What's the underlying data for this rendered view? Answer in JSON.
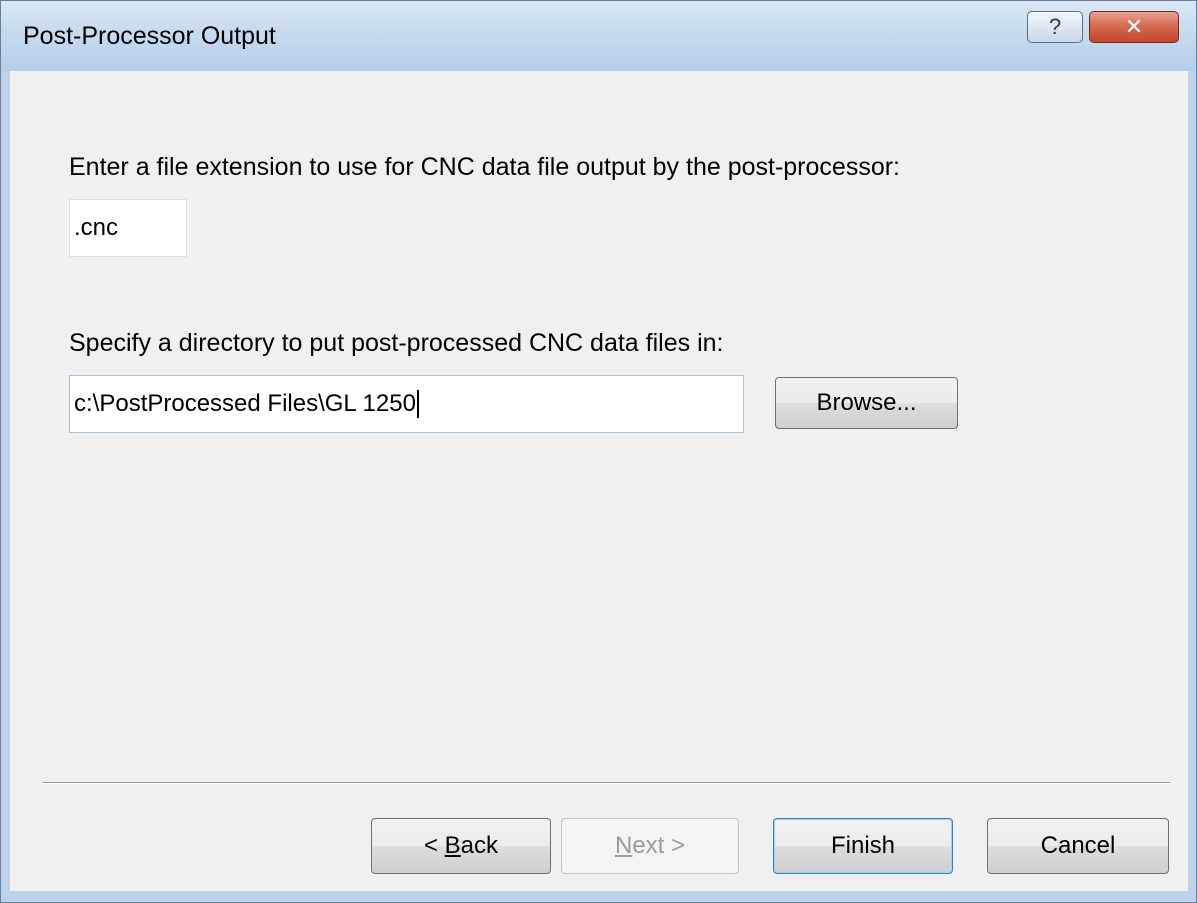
{
  "window": {
    "title": "Post-Processor Output",
    "help_glyph": "?",
    "close_glyph": "✕"
  },
  "extension": {
    "label": "Enter a file extension to use for CNC data file output by the post-processor:",
    "value": ".cnc"
  },
  "directory": {
    "label": "Specify a directory to put post-processed CNC data files in:",
    "value": "c:\\PostProcessed Files\\GL 1250",
    "browse_label": "Browse..."
  },
  "footer": {
    "back": {
      "prefix": "< ",
      "mnemonic": "B",
      "rest": "ack"
    },
    "next": {
      "mnemonic": "N",
      "rest": "ext >",
      "disabled": true
    },
    "finish_label": "Finish",
    "cancel_label": "Cancel"
  }
}
